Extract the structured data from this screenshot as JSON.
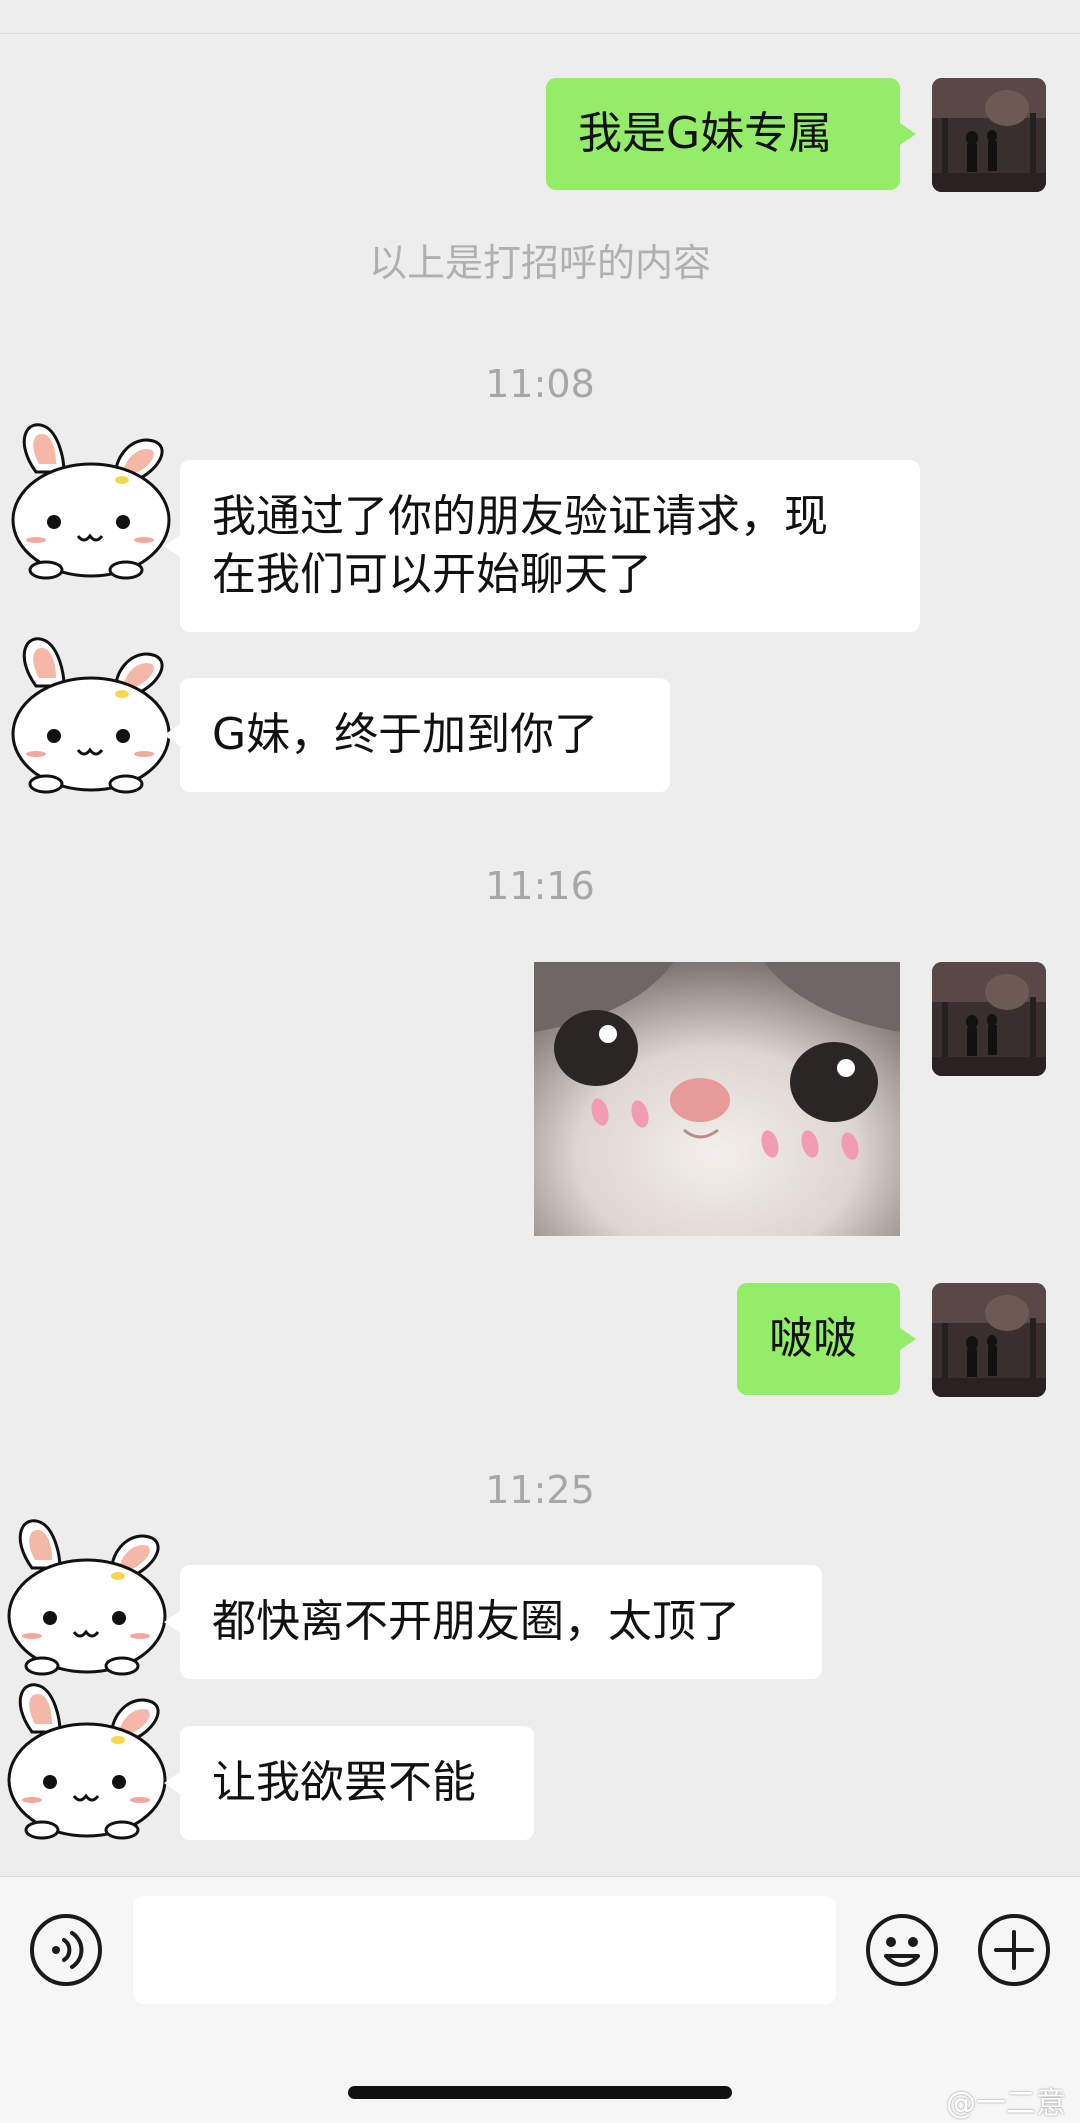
{
  "messages": {
    "m1": "我是G妹专属",
    "greeting_note": "以上是打招呼的内容",
    "time1": "11:08",
    "m2_line1": "我通过了你的朋友验证请求，现",
    "m2_line2": "在我们可以开始聊天了",
    "m3": "G妹，终于加到你了",
    "time2": "11:16",
    "m5": "啵啵",
    "time3": "11:25",
    "m6": "都快离不开朋友圈，太顶了",
    "m7": "让我欲罢不能"
  },
  "composer": {
    "voice_icon": "voice-icon",
    "emoji_icon": "emoji-icon",
    "add_icon": "plus-icon"
  },
  "watermark": "@一二意",
  "colors": {
    "me_bubble": "#95ec69",
    "them_bubble": "#ffffff",
    "background": "#ededed"
  }
}
